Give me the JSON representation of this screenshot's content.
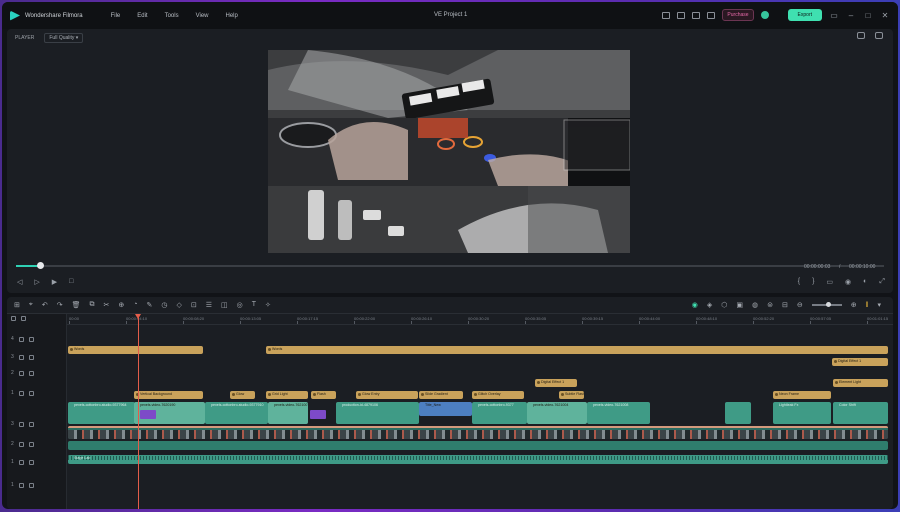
{
  "app": {
    "name": "Wondershare Filmora",
    "menu": [
      "File",
      "Edit",
      "Tools",
      "View",
      "Help"
    ],
    "project_title": "VE Project 1",
    "purchase_label": "Purchase",
    "export_label": "Export"
  },
  "player": {
    "label": "PLAYER",
    "quality": "Full Quality",
    "progress_fraction": 0.028,
    "current_time": "00:00:00:03",
    "separator": "/",
    "total_time": "00:00:10:00"
  },
  "timeline": {
    "ruler_ticks": [
      "00:00",
      "00:00:04:10",
      "00:00:08:20",
      "00:00:13:05",
      "00:00:17:15",
      "00:00:22:00",
      "00:00:26:10",
      "00:00:30:20",
      "00:00:35:05",
      "00:00:39:15",
      "00:00:44:00",
      "00:00:48:10",
      "00:00:52:20",
      "00:00:57:05",
      "00:01:01:15"
    ],
    "tracks": [
      "4",
      "3",
      "2",
      "1",
      "3",
      "2",
      "1",
      "1"
    ],
    "clips": {
      "title_a": "Words",
      "title_b": "Words",
      "sticker_1": "Digital Effect 1",
      "sticker_2": "Digital Effect 1",
      "sticker_3": "Element Light",
      "fx_1": "Vertical Background",
      "fx_2": "Glow",
      "fx_3": "Grid Light",
      "fx_4": "Flash",
      "fx_5": "Glow Entry",
      "fx_6": "Slide Gradient",
      "fx_7": "Glitch Overlay",
      "fx_8": "Subtle Flash",
      "fx_9": "Color Shift",
      "fx_10": "Neon Frame",
      "fx_11": "Lightleak Fx",
      "vid_1": "pexels-cottonbro-studio-9377964",
      "vid_2": "pexels-video-7620190",
      "vid_3": "pexels-cottonbro-studio-9377910",
      "vid_4": "pexels-video-7621007",
      "vid_5": "production-id-4879106",
      "vid_6": "Title_New",
      "vid_7": "pexels-cottonbro-9377",
      "vid_8": "pexels-video-7621004",
      "vid_9": "pexels-video-7621008",
      "audio": "Stage Lab"
    }
  }
}
